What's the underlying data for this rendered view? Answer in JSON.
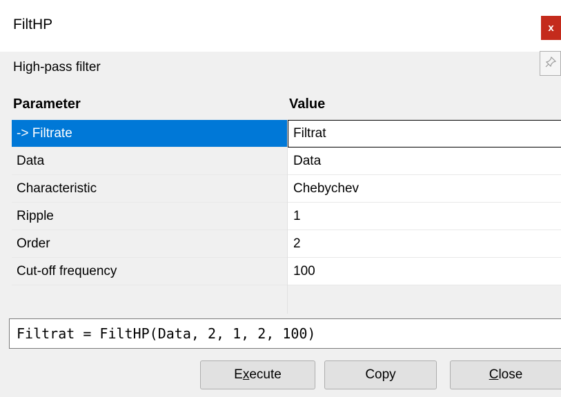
{
  "window": {
    "title": "FiltHP",
    "close_label": "x",
    "description": "High-pass filter"
  },
  "table": {
    "headers": {
      "parameter": "Parameter",
      "value": "Value"
    },
    "rows": [
      {
        "parameter": "-> Filtrate",
        "value": "Filtrat",
        "selected": true
      },
      {
        "parameter": "Data",
        "value": "Data"
      },
      {
        "parameter": "Characteristic",
        "value": "Chebychev"
      },
      {
        "parameter": "Ripple",
        "value": "1"
      },
      {
        "parameter": "Order",
        "value": "2"
      },
      {
        "parameter": "Cut-off frequency",
        "value": "100"
      }
    ]
  },
  "command": "Filtrat = FiltHP(Data, 2, 1, 2, 100)",
  "buttons": {
    "execute": "Execute",
    "copy": "Copy",
    "close": "Close"
  },
  "colors": {
    "selection": "#0078d7",
    "close_button": "#c42b1c"
  },
  "icons": {
    "pin": "pin-icon"
  }
}
